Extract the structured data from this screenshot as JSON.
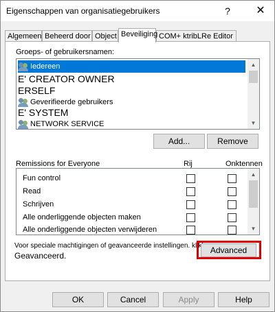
{
  "window": {
    "title": "Eigenschappen van organisatiegebruikers",
    "help_label": "?",
    "close_label": "✕"
  },
  "tabs": [
    {
      "label": "Algemeen"
    },
    {
      "label": "Beheerd door"
    },
    {
      "label": "Object"
    },
    {
      "label": "Beveiliging"
    },
    {
      "label": "COM+ ktribLRe Editor"
    }
  ],
  "groups": {
    "label": "Groeps- of gebruikersnamen:",
    "items": [
      {
        "label": "Iedereen",
        "icon": "users-icon",
        "selected": true
      },
      {
        "label": "E' CREATOR OWNER",
        "icon": "",
        "selected": false
      },
      {
        "label": "ERSELF",
        "icon": "",
        "selected": false
      },
      {
        "label": "Geverifieerde gebruikers",
        "icon": "users-icon",
        "selected": false
      },
      {
        "label": "E' SYSTEM",
        "icon": "",
        "selected": false
      },
      {
        "label": "NETWORK SERVICE",
        "icon": "users-icon",
        "selected": false
      }
    ],
    "add_label": "Add...",
    "remove_label": "Remove"
  },
  "permissions": {
    "label": "Remissions for Everyone",
    "allow_header": "Rij",
    "deny_header": "Onktennen",
    "rows": [
      {
        "name": "Fun control"
      },
      {
        "name": "Read"
      },
      {
        "name": "Schrijven"
      },
      {
        "name": "Alle onderliggende objecten maken"
      },
      {
        "name": "Alle onderliggende objecten verwijderen"
      }
    ]
  },
  "advanced": {
    "text_line1": "Voor speciale machtigingen of geavanceerde instellingen. klikken",
    "text_line2": "Geavanceerd.",
    "button_label": "Advanced"
  },
  "footer": {
    "ok_label": "OK",
    "cancel_label": "Cancel",
    "apply_label": "Apply",
    "help_label": "Help"
  },
  "colors": {
    "selection": "#0078d7",
    "highlight_border": "#e00000"
  }
}
